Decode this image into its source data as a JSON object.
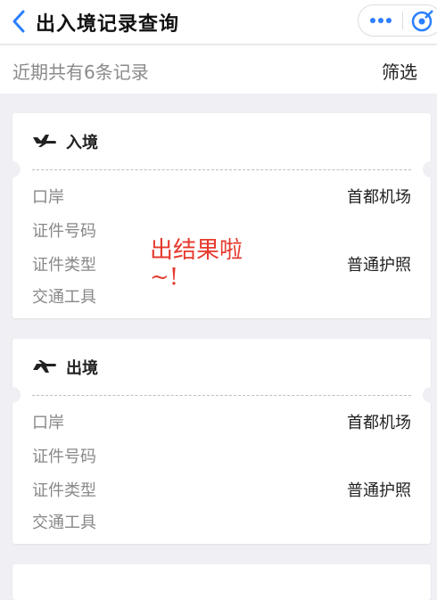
{
  "nav": {
    "title": "出入境记录查询",
    "back_icon": "chevron-left-icon",
    "more_icon": "more-dots-icon",
    "close_icon": "target-close-icon",
    "accent": "#2a7fff"
  },
  "summary": {
    "text": "近期共有6条记录",
    "filter_label": "筛选"
  },
  "records": [
    {
      "type_label": "入境",
      "icon": "plane-arrival-icon",
      "fields": [
        {
          "label": "口岸",
          "value": "首都机场"
        },
        {
          "label": "证件号码",
          "value": ""
        },
        {
          "label": "证件类型",
          "value": "普通护照"
        },
        {
          "label": "交通工具",
          "value": ""
        }
      ]
    },
    {
      "type_label": "出境",
      "icon": "plane-departure-icon",
      "fields": [
        {
          "label": "口岸",
          "value": "首都机场"
        },
        {
          "label": "证件号码",
          "value": ""
        },
        {
          "label": "证件类型",
          "value": "普通护照"
        },
        {
          "label": "交通工具",
          "value": ""
        }
      ]
    }
  ],
  "annotation": {
    "line1": "出结果啦",
    "line2": "~!",
    "color": "#e63a2e"
  }
}
